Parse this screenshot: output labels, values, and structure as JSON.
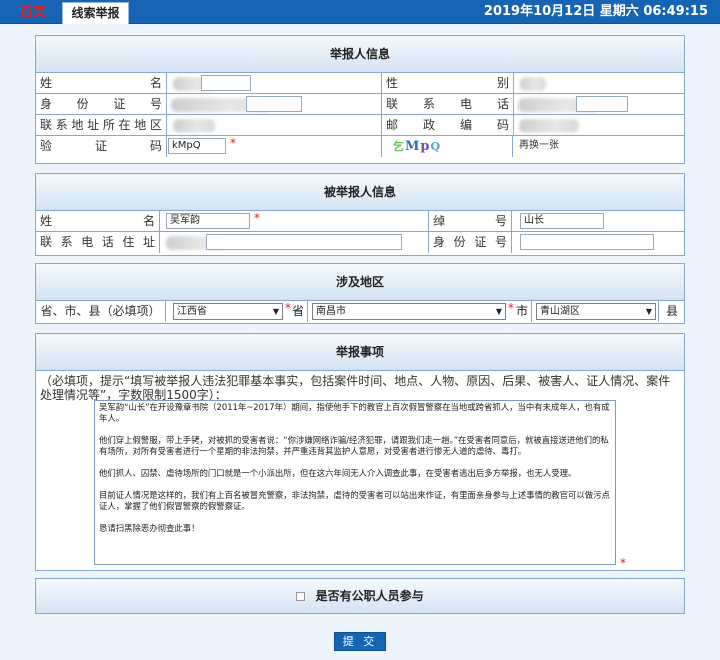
{
  "topbar": {
    "home_tab": "首页",
    "active_tab": "线索举报",
    "datetime": "2019年10月12日 星期六 06:49:15"
  },
  "reporter": {
    "title": "举报人信息",
    "name_label": "姓　　　　名",
    "gender_label": "性　　　　别",
    "id_label": "身　份　证　号",
    "phone_label": "联　系　电　话",
    "address_label": "联系地址所在地区",
    "postcode_label": "邮　政　编　码",
    "captcha_label": "验　　证　　码",
    "captcha_value": "kMpQ",
    "captcha_image_text": [
      "乞",
      "M",
      "p",
      "Q"
    ],
    "refresh_link": "再换一张",
    "required_mark": "*"
  },
  "reported": {
    "title": "被举报人信息",
    "name_label": "姓　　　　名",
    "name_value": "吴军韵",
    "nickname_label": "绰　　号",
    "nickname_value": "山长",
    "phone_address_label": "联系电话住址",
    "id_label": "身份证号",
    "required_mark": "*"
  },
  "region": {
    "title": "涉及地区",
    "label": "省、市、县（必填项）",
    "province_value": "江西省",
    "province_suffix": "省",
    "city_value": "南昌市",
    "city_suffix": "市",
    "county_value": "青山湖区",
    "county_suffix": "县",
    "required_mark": "*"
  },
  "matter": {
    "title": "举报事项",
    "hint": "（必填项，提示“填写被举报人违法犯罪基本事实，包括案件时间、地点、人物、原因、后果、被害人、证人情况、案件处理情况等”，字数限制1500字）：",
    "paragraphs": [
      "吴军韵“山长”在开设豫章书院（2011年~2017年）期间，指使他手下的教官上百次假冒警察在当地或跨省抓人，当中有未成年人，也有成年人。",
      "他们穿上假警服，带上手铐，对被抓的受害者说：“你涉嫌网络诈骗/经济犯罪，请跟我们走一趟。”在受害者同意后，就被直接送进他们的私有场所，对所有受害者进行一个星期的非法拘禁，并严重违背其监护人意愿，对受害者进行惨无人道的虐待、毒打。",
      "他们抓人、囚禁、虐待场所的门口就是一个小派出所，但在这六年间无人介入调查此事，在受害者逃出后多方举报，也无人受理。",
      "目前证人情况是这样的，我们有上百名被冒充警察，非法拘禁，虐待的受害者可以站出来作证，有里面亲身参与上述事情的教官可以做污点证人，掌握了他们假冒警察的假警察证。",
      "恳请扫黑除恶办彻查此事！"
    ],
    "required_mark": "*"
  },
  "civil_servant": {
    "label": "是否有公职人员参与",
    "checked": false
  },
  "submit_label": "提 交"
}
